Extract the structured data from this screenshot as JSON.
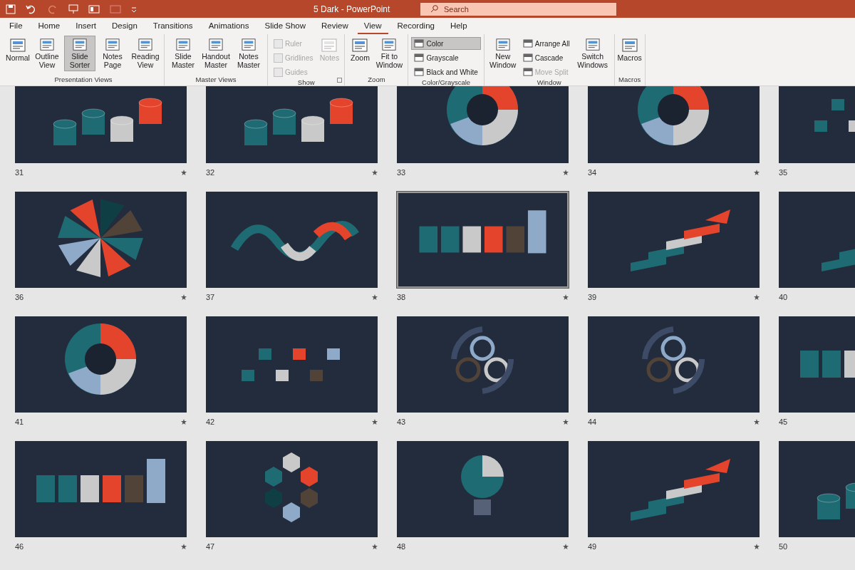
{
  "window": {
    "title": "5 Dark  -  PowerPoint"
  },
  "search": {
    "placeholder": "Search"
  },
  "tabs": [
    {
      "label": "File",
      "selected": false
    },
    {
      "label": "Home",
      "selected": false
    },
    {
      "label": "Insert",
      "selected": false
    },
    {
      "label": "Design",
      "selected": false
    },
    {
      "label": "Transitions",
      "selected": false
    },
    {
      "label": "Animations",
      "selected": false
    },
    {
      "label": "Slide Show",
      "selected": false
    },
    {
      "label": "Review",
      "selected": false
    },
    {
      "label": "View",
      "selected": true
    },
    {
      "label": "Recording",
      "selected": false
    },
    {
      "label": "Help",
      "selected": false
    }
  ],
  "ribbon": [
    {
      "label": "Presentation Views",
      "items": [
        {
          "kind": "big",
          "label": "Normal",
          "selected": false,
          "disabled": false
        },
        {
          "kind": "big",
          "label": "Outline View",
          "selected": false,
          "disabled": false
        },
        {
          "kind": "big",
          "label": "Slide Sorter",
          "selected": true,
          "disabled": false
        },
        {
          "kind": "big",
          "label": "Notes Page",
          "selected": false,
          "disabled": false
        },
        {
          "kind": "big",
          "label": "Reading View",
          "selected": false,
          "disabled": false
        }
      ]
    },
    {
      "label": "Master Views",
      "items": [
        {
          "kind": "big",
          "label": "Slide Master",
          "selected": false,
          "disabled": false
        },
        {
          "kind": "big",
          "label": "Handout Master",
          "selected": false,
          "disabled": false
        },
        {
          "kind": "big",
          "label": "Notes Master",
          "selected": false,
          "disabled": false
        }
      ]
    },
    {
      "label": "Show",
      "launcher": true,
      "items": [
        {
          "kind": "check",
          "label": "Ruler",
          "checked": false,
          "disabled": true
        },
        {
          "kind": "check",
          "label": "Gridlines",
          "checked": false,
          "disabled": true
        },
        {
          "kind": "check",
          "label": "Guides",
          "checked": false,
          "disabled": true
        },
        {
          "kind": "big",
          "label": "Notes",
          "selected": false,
          "disabled": true
        }
      ]
    },
    {
      "label": "Zoom",
      "items": [
        {
          "kind": "big",
          "label": "Zoom",
          "selected": false,
          "disabled": false
        },
        {
          "kind": "big",
          "label": "Fit to Window",
          "selected": false,
          "disabled": false
        }
      ]
    },
    {
      "label": "Color/Grayscale",
      "items": [
        {
          "kind": "small",
          "label": "Color",
          "selected": true,
          "disabled": false
        },
        {
          "kind": "small",
          "label": "Grayscale",
          "selected": false,
          "disabled": false
        },
        {
          "kind": "small",
          "label": "Black and White",
          "selected": false,
          "disabled": false
        }
      ]
    },
    {
      "label": "Window",
      "items": [
        {
          "kind": "big",
          "label": "New Window",
          "selected": false,
          "disabled": false
        },
        {
          "kind": "small",
          "label": "Arrange All",
          "selected": false,
          "disabled": false
        },
        {
          "kind": "small",
          "label": "Cascade",
          "selected": false,
          "disabled": false
        },
        {
          "kind": "small",
          "label": "Move Split",
          "selected": false,
          "disabled": true
        },
        {
          "kind": "menu",
          "label": "Switch Windows",
          "selected": false,
          "disabled": false
        }
      ]
    },
    {
      "label": "Macros",
      "items": [
        {
          "kind": "big",
          "label": "Macros",
          "selected": false,
          "disabled": false
        }
      ]
    }
  ],
  "slides": [
    {
      "number": "31",
      "kind": "cylinders",
      "selected": false
    },
    {
      "number": "32",
      "kind": "cylinders",
      "selected": false
    },
    {
      "number": "33",
      "kind": "ring",
      "selected": false
    },
    {
      "number": "34",
      "kind": "ring",
      "selected": false
    },
    {
      "number": "35",
      "kind": "tiles",
      "selected": false
    },
    {
      "number": "36",
      "kind": "fan",
      "selected": false
    },
    {
      "number": "37",
      "kind": "wave",
      "selected": false
    },
    {
      "number": "38",
      "kind": "blocks",
      "selected": true
    },
    {
      "number": "39",
      "kind": "stairs",
      "selected": false
    },
    {
      "number": "40",
      "kind": "stairs",
      "selected": false
    },
    {
      "number": "41",
      "kind": "ring",
      "selected": false
    },
    {
      "number": "42",
      "kind": "tiles",
      "selected": false
    },
    {
      "number": "43",
      "kind": "cycle",
      "selected": false
    },
    {
      "number": "44",
      "kind": "cycle",
      "selected": false
    },
    {
      "number": "45",
      "kind": "blocks",
      "selected": false
    },
    {
      "number": "46",
      "kind": "blocks",
      "selected": false
    },
    {
      "number": "47",
      "kind": "hexagons",
      "selected": false
    },
    {
      "number": "48",
      "kind": "bulb",
      "selected": false
    },
    {
      "number": "49",
      "kind": "stairs",
      "selected": false
    },
    {
      "number": "50",
      "kind": "cylinders",
      "selected": false
    }
  ]
}
